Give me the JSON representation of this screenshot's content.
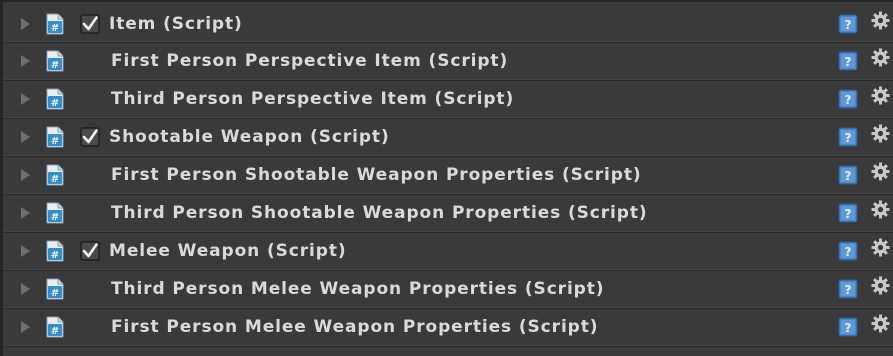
{
  "components": [
    {
      "label": "Item (Script)",
      "has_checkbox": true,
      "checked": true
    },
    {
      "label": "First Person Perspective Item (Script)",
      "has_checkbox": false
    },
    {
      "label": "Third Person Perspective Item (Script)",
      "has_checkbox": false
    },
    {
      "label": "Shootable Weapon (Script)",
      "has_checkbox": true,
      "checked": true
    },
    {
      "label": "First Person Shootable Weapon Properties (Script)",
      "has_checkbox": false
    },
    {
      "label": "Third Person Shootable Weapon Properties (Script)",
      "has_checkbox": false
    },
    {
      "label": "Melee Weapon (Script)",
      "has_checkbox": true,
      "checked": true
    },
    {
      "label": "Third Person Melee Weapon Properties (Script)",
      "has_checkbox": false
    },
    {
      "label": "First Person Melee Weapon Properties (Script)",
      "has_checkbox": false
    }
  ],
  "icons": {
    "script": "csharp-script-icon",
    "help": "help-icon",
    "settings": "gear-icon",
    "foldout": "foldout-arrow-icon"
  },
  "colors": {
    "background": "#3a3a3a",
    "text": "#dadada",
    "script_icon": "#2f8fcf",
    "help_icon": "#4a86c8"
  }
}
